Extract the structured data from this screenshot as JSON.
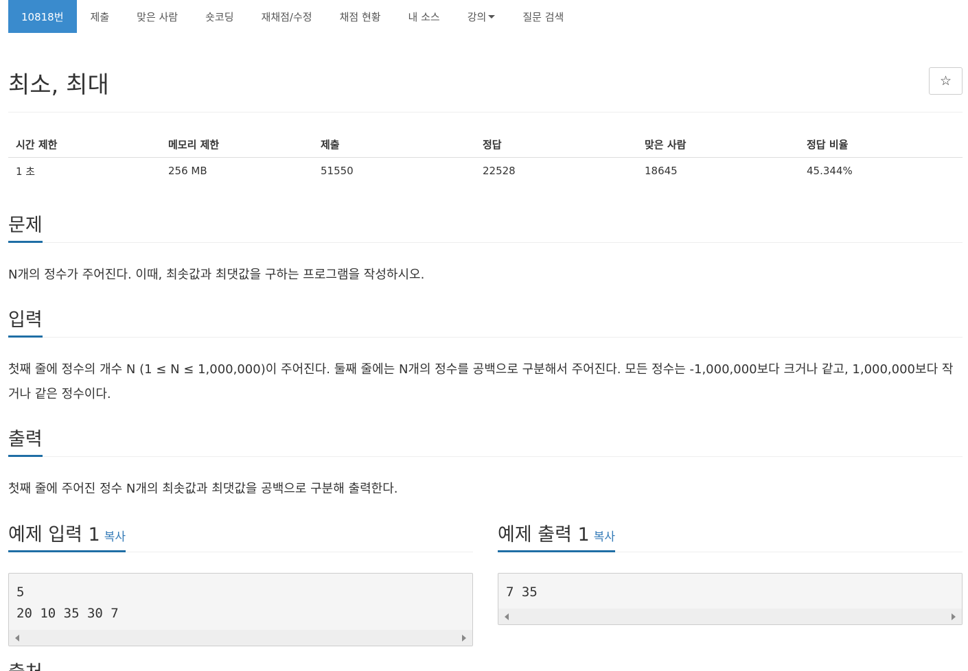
{
  "nav": {
    "tabs": [
      {
        "label": "10818번",
        "active": true
      },
      {
        "label": "제출"
      },
      {
        "label": "맞은 사람"
      },
      {
        "label": "숏코딩"
      },
      {
        "label": "재채점/수정"
      },
      {
        "label": "채점 현황"
      },
      {
        "label": "내 소스"
      },
      {
        "label": "강의",
        "dropdown": true
      },
      {
        "label": "질문 검색"
      }
    ]
  },
  "problem": {
    "title": "최소, 최대",
    "star_icon": "☆"
  },
  "info": {
    "headers": [
      "시간 제한",
      "메모리 제한",
      "제출",
      "정답",
      "맞은 사람",
      "정답 비율"
    ],
    "values": [
      "1 초",
      "256 MB",
      "51550",
      "22528",
      "18645",
      "45.344%"
    ]
  },
  "sections": {
    "description": {
      "title": "문제",
      "text": "N개의 정수가 주어진다. 이때, 최솟값과 최댓값을 구하는 프로그램을 작성하시오."
    },
    "input": {
      "title": "입력",
      "text": "첫째 줄에 정수의 개수 N (1 ≤ N ≤ 1,000,000)이 주어진다. 둘째 줄에는 N개의 정수를 공백으로 구분해서 주어진다. 모든 정수는 -1,000,000보다 크거나 같고, 1,000,000보다 작거나 같은 정수이다."
    },
    "output": {
      "title": "출력",
      "text": "첫째 줄에 주어진 정수 N개의 최솟값과 최댓값을 공백으로 구분해 출력한다."
    }
  },
  "samples": {
    "input": {
      "title": "예제 입력 1",
      "copy_label": "복사",
      "lines": [
        "5",
        "20 10 35 30 7"
      ]
    },
    "output": {
      "title": "예제 출력 1",
      "copy_label": "복사",
      "lines": [
        "7 35"
      ]
    }
  },
  "next_section_fragment": "출처"
}
